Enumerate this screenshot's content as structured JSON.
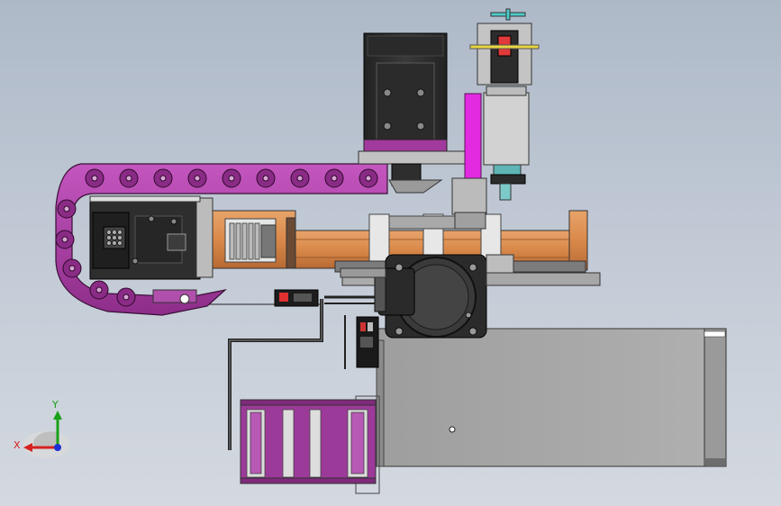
{
  "viewport": {
    "background_top": "#aeb9c8",
    "background_bottom": "#d4d9e0"
  },
  "model": {
    "part_colors": {
      "cable_chain": "#a13a9c",
      "motor_body": "#2f2f2f",
      "motor_flange": "#b7b7b7",
      "linear_rail": "#d9894a",
      "base_housing": "#a9a9a9",
      "magenta_bracket": "#e22ae0",
      "shaft": "#6fc7c7"
    }
  },
  "triad": {
    "x_label": "X",
    "y_label": "Y",
    "x_color": "#d62020",
    "y_color": "#18a018",
    "z_color": "#1c2fd6"
  }
}
